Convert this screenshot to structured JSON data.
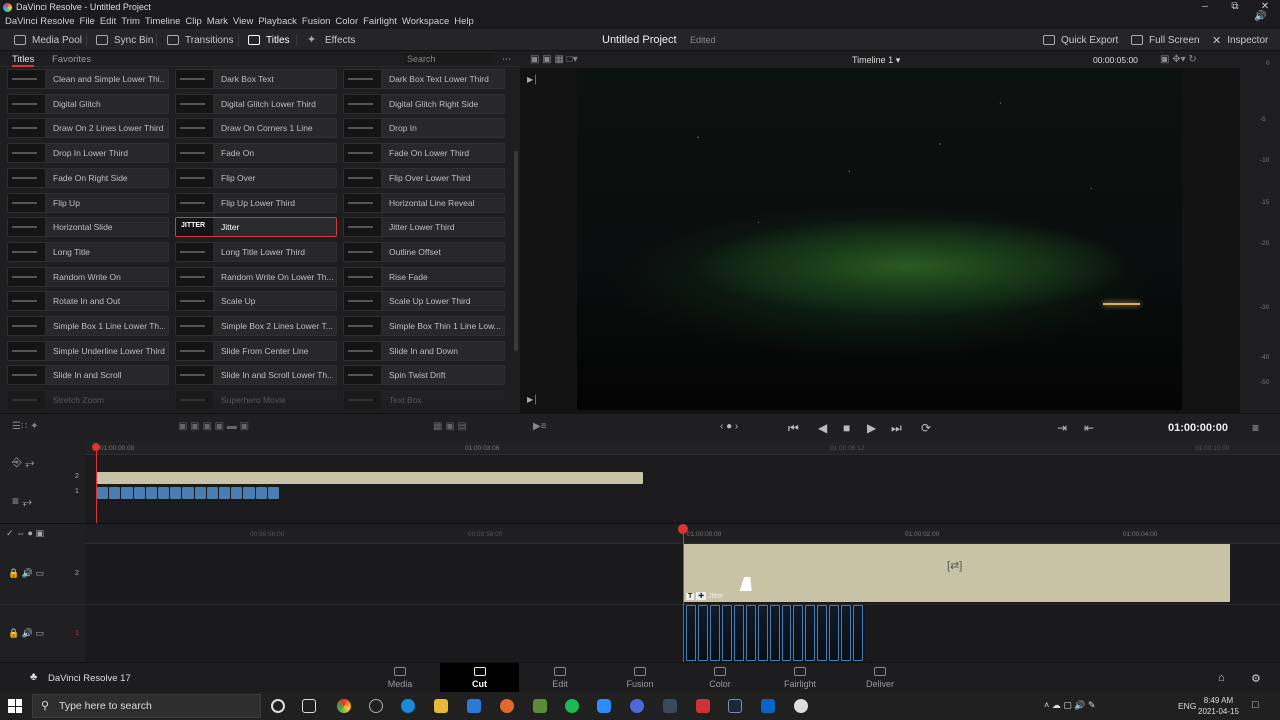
{
  "window": {
    "title": "DaVinci Resolve - Untitled Project"
  },
  "menu": [
    "DaVinci Resolve",
    "File",
    "Edit",
    "Trim",
    "Timeline",
    "Clip",
    "Mark",
    "View",
    "Playback",
    "Fusion",
    "Color",
    "Fairlight",
    "Workspace",
    "Help"
  ],
  "toolbar": {
    "media_pool": "Media Pool",
    "sync_bin": "Sync Bin",
    "transitions": "Transitions",
    "titles": "Titles",
    "effects": "Effects",
    "project_name": "Untitled Project",
    "project_status": "Edited",
    "quick_export": "Quick Export",
    "full_screen": "Full Screen",
    "inspector": "Inspector"
  },
  "panel": {
    "tab_titles": "Titles",
    "tab_favorites": "Favorites",
    "search_placeholder": "Search",
    "selected": "Jitter",
    "items": [
      [
        "Clean and Simple Lower Thi...",
        "Dark Box Text",
        "Dark Box Text Lower Third"
      ],
      [
        "Digital Glitch",
        "Digital Glitch Lower Third",
        "Digital Glitch Right Side"
      ],
      [
        "Draw On 2 Lines Lower Third",
        "Draw On Corners 1 Line",
        "Drop In"
      ],
      [
        "Drop In Lower Third",
        "Fade On",
        "Fade On Lower Third"
      ],
      [
        "Fade On Right Side",
        "Flip Over",
        "Flip Over Lower Third"
      ],
      [
        "Flip Up",
        "Flip Up Lower Third",
        "Horizontal Line Reveal"
      ],
      [
        "Horizontal Slide",
        "Jitter",
        "Jitter Lower Third"
      ],
      [
        "Long Title",
        "Long Title Lower Third",
        "Outline Offset"
      ],
      [
        "Random Write On",
        "Random Write On Lower Th...",
        "Rise Fade"
      ],
      [
        "Rotate In and Out",
        "Scale Up",
        "Scale Up Lower Third"
      ],
      [
        "Simple Box 1 Line Lower Th...",
        "Simple Box 2 Lines Lower T...",
        "Simple Box Thin 1 Line Low..."
      ],
      [
        "Simple Underline Lower Third",
        "Slide From Center Line",
        "Slide In and Down"
      ],
      [
        "Slide In and Scroll",
        "Slide In and Scroll Lower Th...",
        "Spin Twist Drift"
      ],
      [
        "Stretch Zoom",
        "Superhero Movie",
        "Text Box"
      ]
    ],
    "thumb_jitter": "JITTER"
  },
  "viewer": {
    "timeline_name": "Timeline 1",
    "duration": "00:00:05:00"
  },
  "meters": [
    "0",
    "-5",
    "-10",
    "-15",
    "-20",
    "-30",
    "-40",
    "-50"
  ],
  "transport": {
    "timecode": "01:00:00:00"
  },
  "upper_timeline": {
    "ruler": [
      "01:00:00:00",
      "01:00:03:06",
      "01:00:06:12",
      "01:00:10:00"
    ],
    "tracks": [
      "2",
      "1"
    ]
  },
  "lower_timeline": {
    "ruler": [
      "00:59:56:00",
      "00:59:58:00",
      "01:00:00:00",
      "01:00:02:00",
      "01:00:04:00"
    ],
    "tracks": [
      "2",
      "1"
    ],
    "title_clip_label": "Jitter"
  },
  "pages": {
    "brand": "DaVinci Resolve 17",
    "items": [
      "Media",
      "Cut",
      "Edit",
      "Fusion",
      "Color",
      "Fairlight",
      "Deliver"
    ],
    "active": "Cut"
  },
  "taskbar": {
    "search_placeholder": "Type here to search",
    "lang": "ENG",
    "time": "8:49 AM",
    "date": "2021-04-15"
  }
}
